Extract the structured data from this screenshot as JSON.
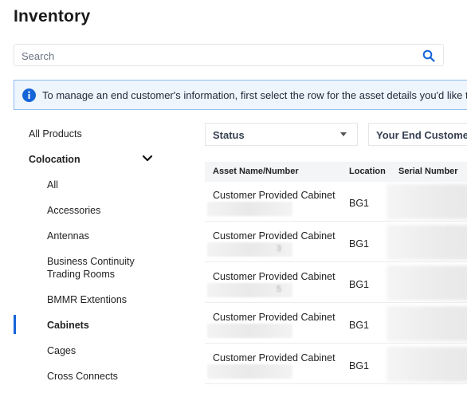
{
  "page": {
    "title": "Inventory"
  },
  "search": {
    "placeholder": "Search",
    "icon": "search-icon"
  },
  "info_banner": {
    "icon": "info-icon",
    "text": "To manage an end customer's information, first select the row for the asset details you'd like to edit, th"
  },
  "sidebar": {
    "all_products": "All Products",
    "category": {
      "label": "Colocation",
      "expanded": true,
      "icon": "chevron-down-icon"
    },
    "items": [
      {
        "label": "All"
      },
      {
        "label": "Accessories"
      },
      {
        "label": "Antennas"
      },
      {
        "label": "Business Continuity\nTrading Rooms"
      },
      {
        "label": "BMMR Extentions"
      },
      {
        "label": "Cabinets",
        "active": true
      },
      {
        "label": "Cages"
      },
      {
        "label": "Cross Connects"
      }
    ]
  },
  "filters": {
    "status": {
      "label": "Status",
      "icon": "caret-down-icon"
    },
    "end_customer": {
      "label": "Your End Customer"
    }
  },
  "table": {
    "headers": [
      "Asset Name/Number",
      "Location",
      "Serial Number"
    ],
    "rows": [
      {
        "name": "Customer Provided Cabinet",
        "id_fragment": "",
        "location": "BG1"
      },
      {
        "name": "Customer Provided Cabinet",
        "id_fragment": "3",
        "location": "BG1"
      },
      {
        "name": "Customer Provided Cabinet",
        "id_fragment": "5",
        "location": "BG1"
      },
      {
        "name": "Customer Provided Cabinet",
        "id_fragment": "",
        "location": "BG1"
      },
      {
        "name": "Customer Provided Cabinet",
        "id_fragment": "",
        "location": "BG1"
      }
    ]
  },
  "colors": {
    "accent": "#1565d8",
    "banner_bg": "#eef5fd",
    "banner_border": "#8fbcef",
    "table_header_bg": "#f4f5f7"
  }
}
